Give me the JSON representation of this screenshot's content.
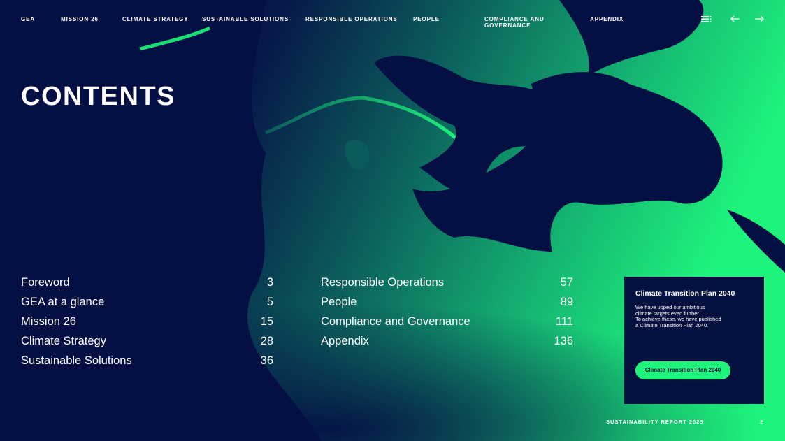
{
  "nav": {
    "items": [
      {
        "label": "GEA"
      },
      {
        "label": "MISSION 26"
      },
      {
        "label": "CLIMATE STRATEGY"
      },
      {
        "label": "SUSTAINABLE SOLUTIONS"
      },
      {
        "label": "RESPONSIBLE OPERATIONS"
      },
      {
        "label": "PEOPLE"
      },
      {
        "label": "COMPLIANCE AND GOVERNANCE"
      },
      {
        "label": "APPENDIX"
      }
    ],
    "icons": [
      "menu-icon",
      "arrow-left-icon",
      "arrow-right-icon"
    ]
  },
  "page": {
    "title": "CONTENTS"
  },
  "toc": {
    "left": [
      {
        "label": "Foreword",
        "page": "3"
      },
      {
        "label": "GEA at a glance",
        "page": "5"
      },
      {
        "label": "Mission 26",
        "page": "15"
      },
      {
        "label": "Climate Strategy",
        "page": "28"
      },
      {
        "label": "Sustainable Solutions",
        "page": "36"
      }
    ],
    "right": [
      {
        "label": "Responsible Operations",
        "page": "57"
      },
      {
        "label": "People",
        "page": "89"
      },
      {
        "label": "Compliance and Governance",
        "page": "111"
      },
      {
        "label": "Appendix",
        "page": "136"
      }
    ]
  },
  "card": {
    "title": "Climate Transition Plan 2040",
    "lines": [
      "We have upped our ambitious",
      "climate targets even further.",
      "To achieve these, we have published",
      "a Climate Transition Plan 2040."
    ],
    "button_label": "Climate Transition Plan 2040"
  },
  "footer": {
    "label": "SUSTAINABILITY REPORT 2023",
    "page_number": "2"
  },
  "colors": {
    "navy": "#040f44",
    "accent_green": "#1ef47c"
  }
}
